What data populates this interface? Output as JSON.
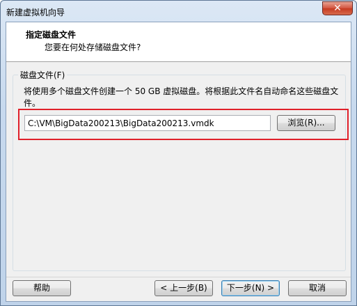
{
  "window": {
    "title": "新建虚拟机向导",
    "close_symbol": "✕"
  },
  "header": {
    "title": "指定磁盘文件",
    "subtitle": "您要在何处存储磁盘文件?"
  },
  "disk_file": {
    "group_label": "磁盘文件(F)",
    "description": "将使用多个磁盘文件创建一个 50 GB 虚拟磁盘。将根据此文件名自动命名这些磁盘文件。",
    "path_value": "C:\\VM\\BigData200213\\BigData200213.vmdk",
    "browse_label": "浏览(R)..."
  },
  "footer": {
    "help_label": "帮助",
    "back_label": "< 上一步(B)",
    "next_label": "下一步(N) >",
    "cancel_label": "取消"
  },
  "colors": {
    "highlight": "#e0202a",
    "title_gradient": "#c7d9ee"
  }
}
